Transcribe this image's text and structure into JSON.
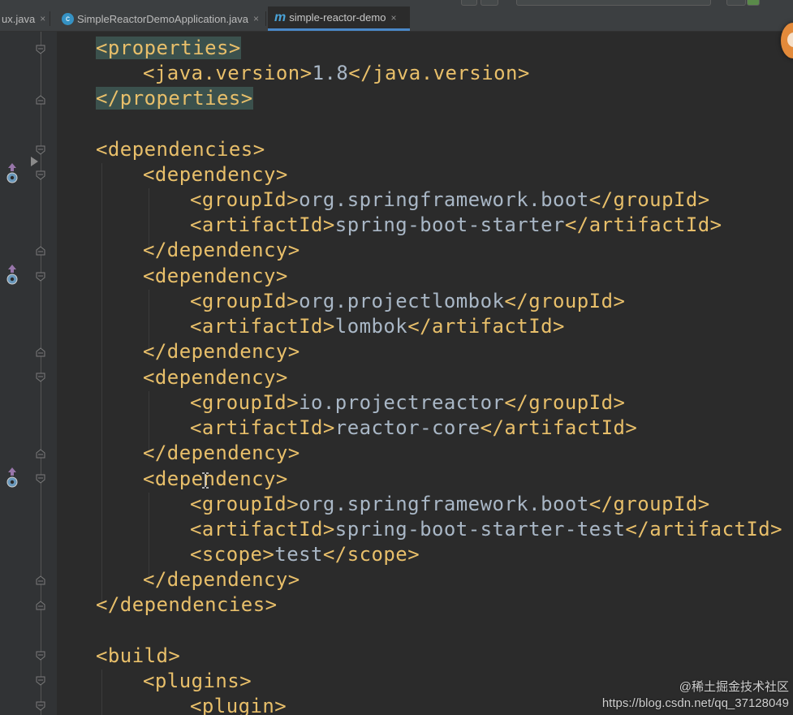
{
  "tabs": [
    {
      "label": "ux.java",
      "icon": "java-class-icon",
      "active": false
    },
    {
      "label": "SimpleReactorDemoApplication.java",
      "icon": "spring-boot-class-icon",
      "active": false
    },
    {
      "label": "simple-reactor-demo",
      "icon": "maven-icon",
      "active": true
    }
  ],
  "icons": {
    "close": "×",
    "maven": "m",
    "spring_class": "c"
  },
  "colors": {
    "background": "#2b2b2b",
    "gutter": "#313335",
    "xml_tag": "#e8bf6a",
    "xml_text": "#a9b7c6",
    "tab_active_underline": "#4a88c7",
    "highlight": "#3b514d"
  },
  "code": {
    "l1": {
      "open": "<properties>"
    },
    "l2": {
      "open": "<java.version>",
      "value": "1.8",
      "close": "</java.version>"
    },
    "l3": {
      "close": "</properties>"
    },
    "l5": {
      "open": "<dependencies>"
    },
    "l6": {
      "open": "<dependency>"
    },
    "l7": {
      "open": "<groupId>",
      "value": "org.springframework.boot",
      "close": "</groupId>"
    },
    "l8": {
      "open": "<artifactId>",
      "value": "spring-boot-starter",
      "close": "</artifactId>"
    },
    "l9": {
      "close": "</dependency>"
    },
    "l10": {
      "open": "<dependency>"
    },
    "l11": {
      "open": "<groupId>",
      "value": "org.projectlombok",
      "close": "</groupId>"
    },
    "l12": {
      "open": "<artifactId>",
      "value": "lombok",
      "close": "</artifactId>"
    },
    "l13": {
      "close": "</dependency>"
    },
    "l14": {
      "open": "<dependency>"
    },
    "l15": {
      "open": "<groupId>",
      "value": "io.projectreactor",
      "close": "</groupId>"
    },
    "l16": {
      "open": "<artifactId>",
      "value": "reactor-core",
      "close": "</artifactId>"
    },
    "l17": {
      "close": "</dependency>"
    },
    "l18": {
      "open": "<dependency>"
    },
    "l19": {
      "open": "<groupId>",
      "value": "org.springframework.boot",
      "close": "</groupId>"
    },
    "l20": {
      "open": "<artifactId>",
      "value": "spring-boot-starter-test",
      "close": "</artifactId>"
    },
    "l21": {
      "open": "<scope>",
      "value": "test",
      "close": "</scope>"
    },
    "l22": {
      "close": "</dependency>"
    },
    "l23": {
      "close": "</dependencies>"
    },
    "l25": {
      "open": "<build>"
    },
    "l26": {
      "open": "<plugins>"
    },
    "l27": {
      "open": "<plugin>"
    }
  },
  "watermark": {
    "line1": "@稀土掘金技术社区",
    "line2": "https://blog.csdn.net/qq_37128049"
  }
}
